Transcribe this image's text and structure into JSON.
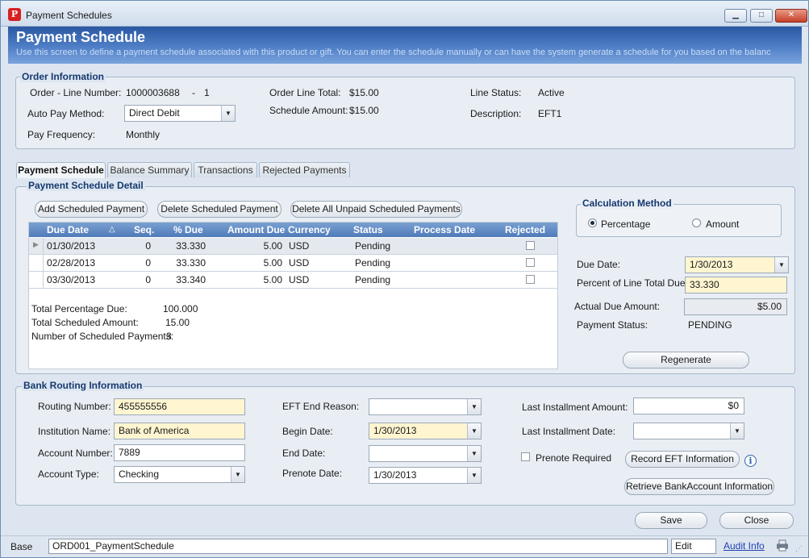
{
  "window": {
    "title": "Payment Schedules",
    "icon": "app-logo-icon",
    "minimize": "▁",
    "maximize": "□",
    "close": "✕"
  },
  "banner": {
    "title": "Payment Schedule",
    "subtitle": "Use this screen to define a payment schedule associated with this product or gift. You can enter the schedule manually or can have the system generate a schedule for you based on the balanc"
  },
  "order_info": {
    "title": "Order Information",
    "order_line_label": "Order - Line Number:",
    "order_number": "1000003688",
    "dash": "-",
    "line_number": "1",
    "order_line_total_label": "Order Line Total:",
    "order_line_total": "$15.00",
    "line_status_label": "Line Status:",
    "line_status": "Active",
    "auto_pay_label": "Auto Pay Method:",
    "auto_pay_value": "Direct Debit",
    "schedule_amount_label": "Schedule Amount:",
    "schedule_amount": "$15.00",
    "description_label": "Description:",
    "description": "EFT1",
    "pay_frequency_label": "Pay Frequency:",
    "pay_frequency": "Monthly"
  },
  "tabs": [
    {
      "label": "Payment Schedule",
      "active": true
    },
    {
      "label": "Balance Summary",
      "active": false
    },
    {
      "label": "Transactions",
      "active": false
    },
    {
      "label": "Rejected Payments",
      "active": false
    }
  ],
  "schedule_detail": {
    "title": "Payment Schedule Detail",
    "add_button": "Add Scheduled Payment",
    "delete_button": "Delete Scheduled Payment",
    "delete_all_button": "Delete All Unpaid Scheduled Payments",
    "columns": [
      "Due Date",
      "Seq.",
      "% Due",
      "Amount Due",
      "Currency",
      "Status",
      "Process Date",
      "Rejected"
    ],
    "sort_indicator": "△",
    "rows": [
      {
        "due_date": "01/30/2013",
        "seq": "0",
        "pct_due": "33.330",
        "amount_due": "5.00",
        "currency": "USD",
        "status": "Pending",
        "process_date": "",
        "rejected": false
      },
      {
        "due_date": "02/28/2013",
        "seq": "0",
        "pct_due": "33.330",
        "amount_due": "5.00",
        "currency": "USD",
        "status": "Pending",
        "process_date": "",
        "rejected": false
      },
      {
        "due_date": "03/30/2013",
        "seq": "0",
        "pct_due": "33.340",
        "amount_due": "5.00",
        "currency": "USD",
        "status": "Pending",
        "process_date": "",
        "rejected": false
      }
    ],
    "total_pct_label": "Total Percentage Due:",
    "total_pct": "100.000",
    "total_sched_label": "Total Scheduled Amount:",
    "total_sched": "15.00",
    "num_payments_label": "Number of Scheduled Payments:",
    "num_payments": "3"
  },
  "calc_method": {
    "title": "Calculation Method",
    "percentage_label": "Percentage",
    "amount_label": "Amount",
    "selected": "percentage"
  },
  "detail_right": {
    "due_date_label": "Due Date:",
    "due_date": "1/30/2013",
    "percent_label": "Percent of Line Total Due:",
    "percent": "33.330",
    "actual_due_label": "Actual Due Amount:",
    "actual_due": "$5.00",
    "payment_status_label": "Payment Status:",
    "payment_status": "PENDING",
    "regenerate_button": "Regenerate"
  },
  "bank_routing": {
    "title": "Bank Routing Information",
    "routing_label": "Routing Number:",
    "routing": "455555556",
    "institution_label": "Institution Name:",
    "institution": "Bank of America",
    "account_number_label": "Account Number:",
    "account_number": "7889",
    "account_type_label": "Account Type:",
    "account_type": "Checking",
    "eft_end_label": "EFT End Reason:",
    "eft_end": "",
    "begin_date_label": "Begin Date:",
    "begin_date": "1/30/2013",
    "end_date_label": "End Date:",
    "end_date": "",
    "prenote_date_label": "Prenote Date:",
    "prenote_date": "1/30/2013",
    "last_amount_label": "Last Installment Amount:",
    "last_amount": "$0",
    "last_date_label": "Last Installment Date:",
    "last_date": "",
    "prenote_required_label": "Prenote Required",
    "record_eft_button": "Record EFT Information",
    "retrieve_button": "Retrieve BankAccount Information"
  },
  "footer": {
    "save": "Save",
    "close": "Close"
  },
  "statusbar": {
    "base": "Base",
    "form_id": "ORD001_PaymentSchedule",
    "mode": "Edit",
    "audit_info": "Audit Info"
  }
}
